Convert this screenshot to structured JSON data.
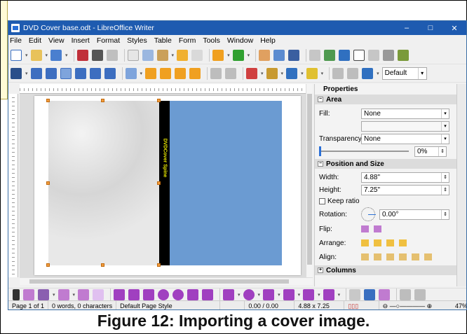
{
  "window": {
    "title": "DVD Cover base.odt - LibreOffice Writer",
    "min": "–",
    "max": "□",
    "close": "✕"
  },
  "menu": [
    "File",
    "Edit",
    "View",
    "Insert",
    "Format",
    "Styles",
    "Table",
    "Form",
    "Tools",
    "Window",
    "Help"
  ],
  "toolbar": {
    "para_style": "Default"
  },
  "document": {
    "spine_text": "DVDCover Spine"
  },
  "sidebar": {
    "title": "Properties",
    "area": {
      "header": "Area",
      "fill_label": "Fill:",
      "fill_value": "None",
      "transparency_label": "Transparency:",
      "transparency_value": "None",
      "transparency_pct": "0%"
    },
    "pos": {
      "header": "Position and Size",
      "width_label": "Width:",
      "width_value": "4.88\"",
      "height_label": "Height:",
      "height_value": "7.25\"",
      "keep_ratio": "Keep ratio",
      "rotation_label": "Rotation:",
      "rotation_value": "0.00°",
      "flip_label": "Flip:",
      "arrange_label": "Arrange:",
      "align_label": "Align:"
    },
    "columns": "Columns"
  },
  "status": {
    "page": "Page 1 of 1",
    "words": "0 words, 0 characters",
    "style": "Default Page Style",
    "pos": "0.00 / 0.00",
    "size": "4.88 x 7.25",
    "zoom": "47%"
  },
  "caption": "Figure 12: Importing a cover image.",
  "colors": {
    "title_bar": "#1e5bb0",
    "cover_blue": "#6b9bd2",
    "spine_text": "#e8e800"
  }
}
